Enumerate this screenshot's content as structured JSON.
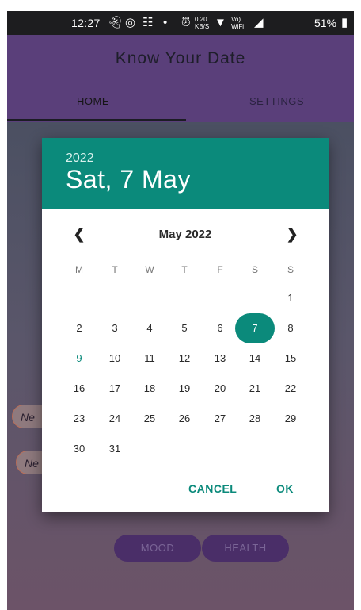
{
  "status_bar": {
    "time": "12:27",
    "network_speed_top": "0.20",
    "network_speed_bottom": "KB/S",
    "volte_top": "Vo)",
    "volte_bottom": "WiFi",
    "battery": "51%"
  },
  "app": {
    "title": "Know Your Date",
    "tabs": [
      {
        "label": "HOME",
        "active": true
      },
      {
        "label": "SETTINGS",
        "active": false
      }
    ]
  },
  "background": {
    "field_hints": [
      "Ne",
      "Ne"
    ],
    "buttons": [
      "MOOD",
      "HEALTH"
    ]
  },
  "date_picker": {
    "header_year": "2022",
    "header_date": "Sat, 7 May",
    "month_label": "May 2022",
    "prev_icon": "chevron-left",
    "next_icon": "chevron-right",
    "weekdays": [
      "M",
      "T",
      "W",
      "T",
      "F",
      "S",
      "S"
    ],
    "first_weekday_index": 6,
    "days_in_month": 31,
    "selected_day": 7,
    "today_day": 9,
    "cancel_label": "CANCEL",
    "ok_label": "OK",
    "accent_color": "#0b8a7b"
  }
}
